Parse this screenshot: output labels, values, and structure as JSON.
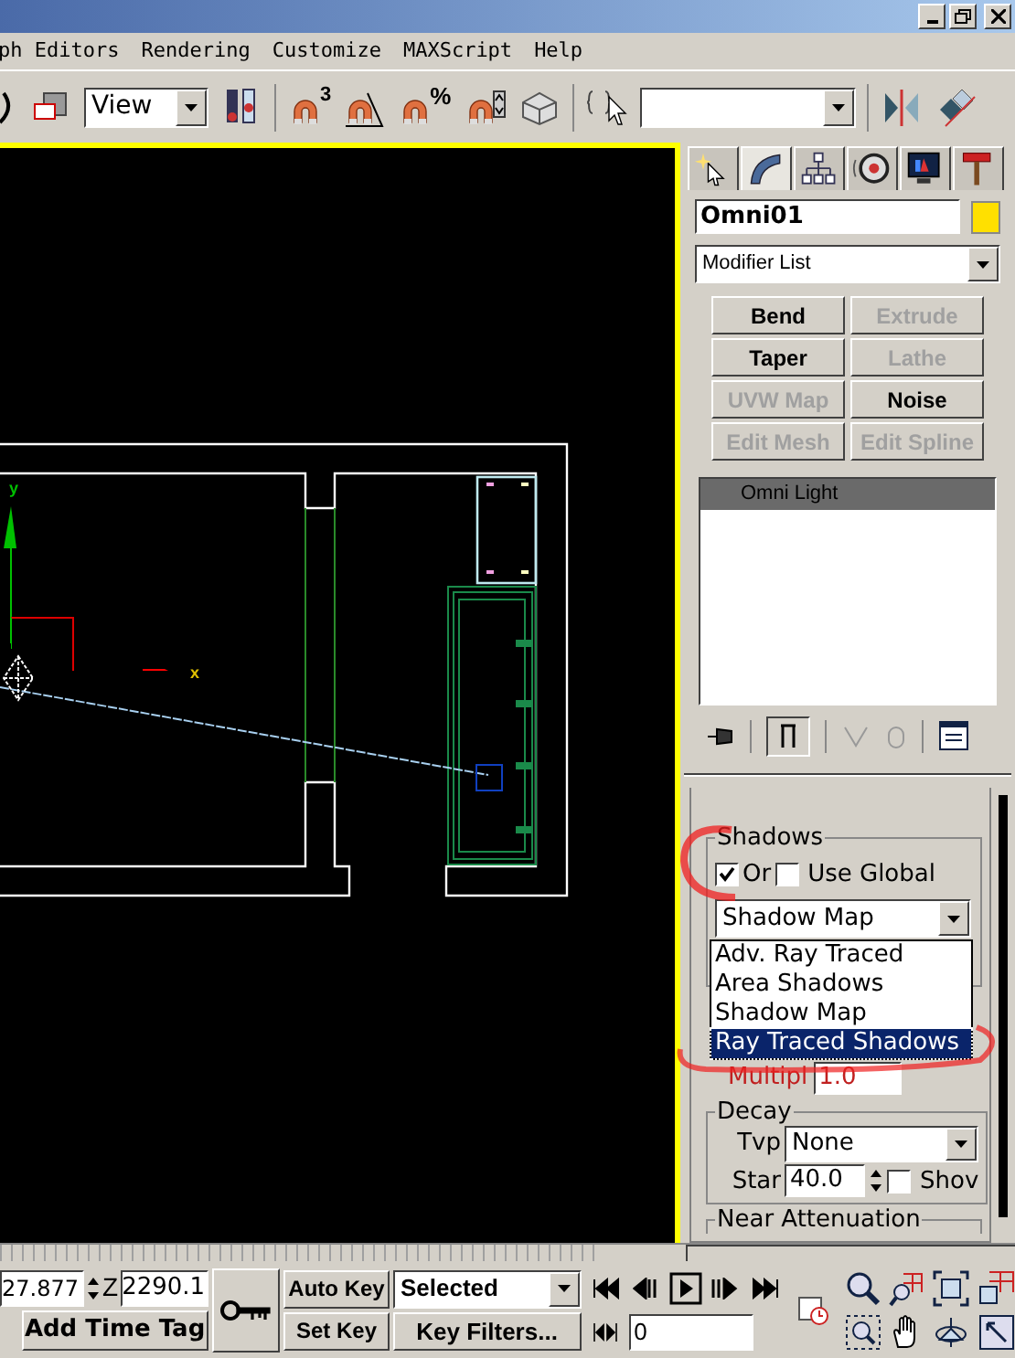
{
  "menu": [
    {
      "label": "ph Editors"
    },
    {
      "label": "Rendering"
    },
    {
      "label": "Customize"
    },
    {
      "label": "MAXScript"
    },
    {
      "label": "Help"
    }
  ],
  "toolbar": {
    "view_select": "View",
    "snap_label": "3",
    "percent_label": "%"
  },
  "viewport": {
    "active": true,
    "y_label": "y",
    "x_label": "x"
  },
  "command_panel": {
    "tabs": [
      {
        "selected": false
      },
      {
        "selected": true
      },
      {
        "selected": false
      },
      {
        "selected": false
      },
      {
        "selected": false
      },
      {
        "selected": false
      }
    ],
    "object_name": "Omni01",
    "modifier_list": "Modifier List",
    "modifier_buttons": [
      {
        "label": "Bend",
        "disabled": false
      },
      {
        "label": "Extrude",
        "disabled": true
      },
      {
        "label": "Taper",
        "disabled": false
      },
      {
        "label": "Lathe",
        "disabled": true
      },
      {
        "label": "UVW Map",
        "disabled": true
      },
      {
        "label": "Noise",
        "disabled": false
      },
      {
        "label": "Edit Mesh",
        "disabled": true
      },
      {
        "label": "Edit Spline",
        "disabled": true
      }
    ],
    "stack": [
      {
        "label": "Omni Light",
        "selected": true
      }
    ],
    "shadows": {
      "title": "Shadows",
      "on_label": "Or",
      "on_checked": true,
      "global_label": "Use Global",
      "global_checked": false,
      "type": "Shadow Map",
      "options": [
        {
          "label": "Adv. Ray Traced",
          "selected": false
        },
        {
          "label": "Area Shadows",
          "selected": false
        },
        {
          "label": "Shadow Map",
          "selected": false
        },
        {
          "label": "Ray Traced Shadows",
          "selected": true
        }
      ]
    },
    "multiplier": {
      "label": "Multipl",
      "value": "1.0"
    },
    "decay": {
      "title": "Decay",
      "type_label": "Tvp",
      "type": "None",
      "start_label": "Star",
      "start": "40.0",
      "show_label": "Shov",
      "show_checked": false
    },
    "near_attenuation": {
      "title": "Near Attenuation"
    }
  },
  "bottom": {
    "x_value": "27.877",
    "z_label": "Z",
    "z_value": "2290.1",
    "add_time_tag": "Add Time Tag",
    "auto_key": "Auto Key",
    "set_key": "Set Key",
    "key_mode": "Selected",
    "key_filters": "Key Filters...",
    "frame": "0"
  }
}
